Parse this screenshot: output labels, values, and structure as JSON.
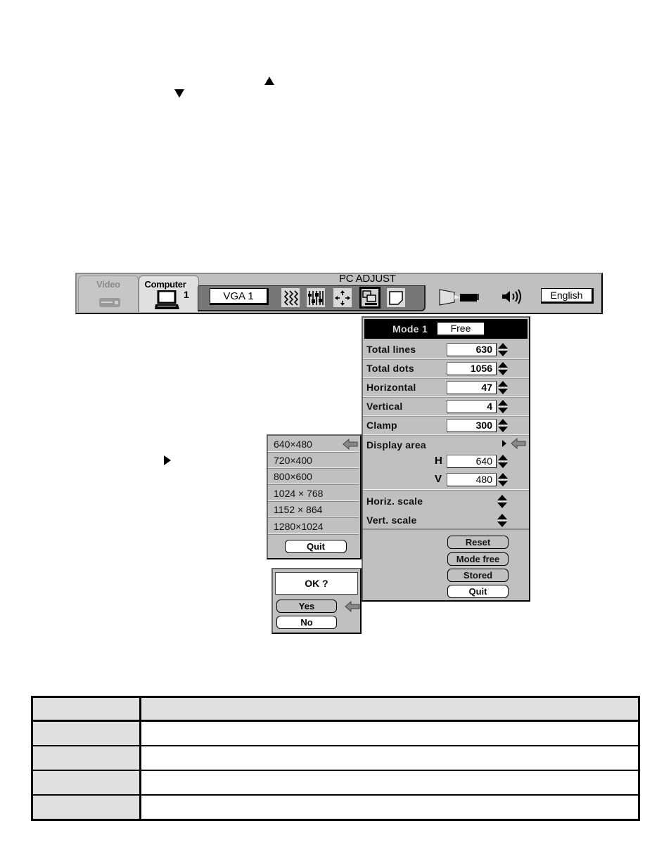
{
  "markers": {
    "up_arrow": "up-triangle",
    "down_arrow": "down-triangle",
    "right_pointer": "right-triangle"
  },
  "menubar": {
    "title": "PC ADJUST",
    "tabs": [
      {
        "label": "Video",
        "icon": "vcr-icon",
        "active": false
      },
      {
        "label": "Computer",
        "icon": "computer-monitor-icon",
        "active": true,
        "input_number": "1"
      }
    ],
    "source_label": "VGA 1",
    "tools": [
      {
        "icon": "fine-sync-icon"
      },
      {
        "icon": "total-dots-icon"
      },
      {
        "icon": "position-icon"
      },
      {
        "icon": "pc-adjust-icon",
        "selected": true
      },
      {
        "icon": "image-level-icon"
      }
    ],
    "screen_icon": "screen-projector-icon",
    "sound_icon": "speaker-icon",
    "language_label": "English"
  },
  "pc_adjust": {
    "mode_label": "Mode 1",
    "mode_value": "Free",
    "rows": [
      {
        "label": "Total lines",
        "value": "630"
      },
      {
        "label": "Total dots",
        "value": "1056"
      },
      {
        "label": "Horizontal",
        "value": "47"
      },
      {
        "label": "Vertical",
        "value": "4"
      },
      {
        "label": "Clamp",
        "value": "300"
      }
    ],
    "display_area": {
      "label": "Display area",
      "h_label": "H",
      "h_value": "640",
      "v_label": "V",
      "v_value": "480"
    },
    "horiz_scale_label": "Horiz. scale",
    "vert_scale_label": "Vert. scale",
    "buttons": {
      "reset": "Reset",
      "mode_free": "Mode free",
      "stored": "Stored",
      "quit": "Quit"
    }
  },
  "resolution_menu": {
    "items": [
      "640×480",
      "720×400",
      "800×600",
      "1024 × 768",
      "1152 × 864",
      "1280×1024"
    ],
    "selected_index": 0,
    "quit_label": "Quit"
  },
  "confirm_dialog": {
    "title": "OK ?",
    "yes_label": "Yes",
    "no_label": "No"
  },
  "table": {
    "rows": [
      [
        "",
        ""
      ],
      [
        "",
        ""
      ],
      [
        "",
        ""
      ],
      [
        "",
        ""
      ],
      [
        "",
        ""
      ]
    ]
  }
}
